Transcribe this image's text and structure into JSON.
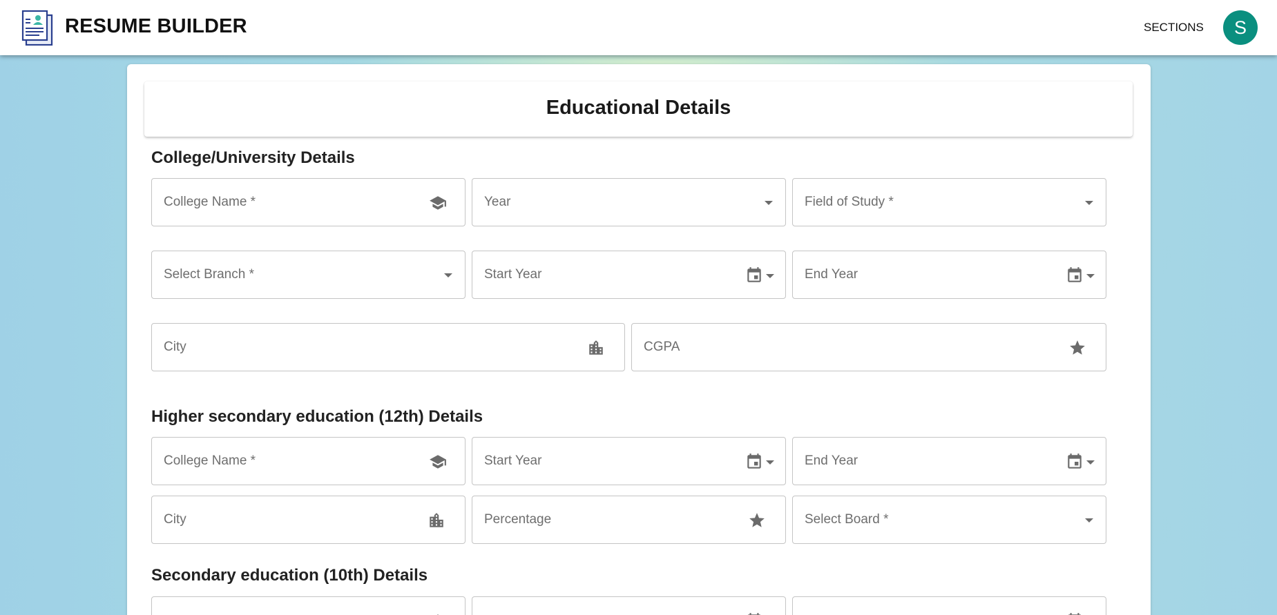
{
  "app": {
    "title": "RESUME BUILDER",
    "sections_label": "SECTIONS",
    "avatar_initial": "S"
  },
  "page": {
    "title": "Educational Details"
  },
  "college": {
    "heading": "College/University Details",
    "college_name": "College Name *",
    "year": "Year",
    "field_of_study": "Field of Study *",
    "branch": "Select Branch *",
    "start_year": "Start Year",
    "end_year": "End Year",
    "city": "City",
    "cgpa": "CGPA"
  },
  "higher_secondary": {
    "heading": "Higher secondary education (12th) Details",
    "college_name": "College Name *",
    "start_year": "Start Year",
    "end_year": "End Year",
    "city": "City",
    "percentage": "Percentage",
    "board": "Select Board *"
  },
  "secondary": {
    "heading": "Secondary education (10th) Details"
  },
  "colors": {
    "accent_avatar": "#0a8f7f",
    "icon": "#6b6b6b",
    "border": "#c4c4c4"
  },
  "icons": [
    "school-icon",
    "chevron-down-icon",
    "calendar-icon",
    "city-icon",
    "star-icon",
    "resume-logo"
  ]
}
